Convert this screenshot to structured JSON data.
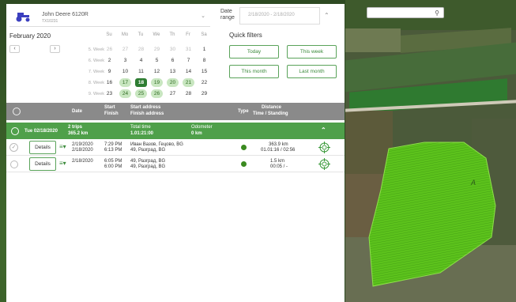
{
  "vehicle": {
    "name": "John Deere 6120R",
    "id": "TX10231"
  },
  "date_range": {
    "label_line1": "Date",
    "label_line2": "range",
    "value": "2/18/2020 - 2/18/2020"
  },
  "calendar": {
    "month": "February 2020",
    "weekdays": [
      "Su",
      "Mo",
      "Tu",
      "We",
      "Th",
      "Fr",
      "Sa"
    ],
    "weeks": [
      {
        "label": "5. Week",
        "days": [
          "26",
          "27",
          "28",
          "29",
          "30",
          "31",
          "1"
        ]
      },
      {
        "label": "6. Week",
        "days": [
          "2",
          "3",
          "4",
          "5",
          "6",
          "7",
          "8"
        ]
      },
      {
        "label": "7. Week",
        "days": [
          "9",
          "10",
          "11",
          "12",
          "13",
          "14",
          "15"
        ]
      },
      {
        "label": "8. Week",
        "days": [
          "16",
          "17",
          "18",
          "19",
          "20",
          "21",
          "22"
        ]
      },
      {
        "label": "9. Week",
        "days": [
          "23",
          "24",
          "25",
          "26",
          "27",
          "28",
          "29"
        ]
      }
    ]
  },
  "quick_filters": {
    "title": "Quick filters",
    "today": "Today",
    "this_week": "This week",
    "this_month": "This month",
    "last_month": "Last month"
  },
  "table": {
    "col_date": "Date",
    "col_start": "Start",
    "col_finish": "Finish",
    "col_start_address": "Start address",
    "col_finish_address": "Finish address",
    "col_type": "Type",
    "col_distance": "Distance",
    "col_time": "Time / Standing"
  },
  "group": {
    "date": "Tue 02/18/2020",
    "trips": "2 trips",
    "distance": "365.2 km",
    "total_label": "Total time",
    "total_value": "1.01:21:00",
    "odometer_label": "Odometer",
    "odometer_value": "0 km"
  },
  "trips": [
    {
      "details": "Details",
      "start_date": "2/19/2020",
      "finish_date": "2/18/2020",
      "start_time": "7:29 PM",
      "finish_time": "6:13 PM",
      "start_address": "Иван Вазов, Гецово, BG",
      "finish_address": "49, Разград, BG",
      "distance": "363.9 km",
      "time": "01.01:16 / 02:56"
    },
    {
      "details": "Details",
      "start_date": "2/18/2020",
      "finish_date": "",
      "start_time": "6:05 PM",
      "finish_time": "6:00 PM",
      "start_address": "49, Разград, BG",
      "finish_address": "49, Разград, BG",
      "distance": "1.5 km",
      "time": "00:05 / -"
    }
  ],
  "map": {
    "field_label": "A"
  },
  "colors": {
    "accent": "#4fa04a",
    "header": "#8a8a8a",
    "field": "#5cc21c"
  }
}
